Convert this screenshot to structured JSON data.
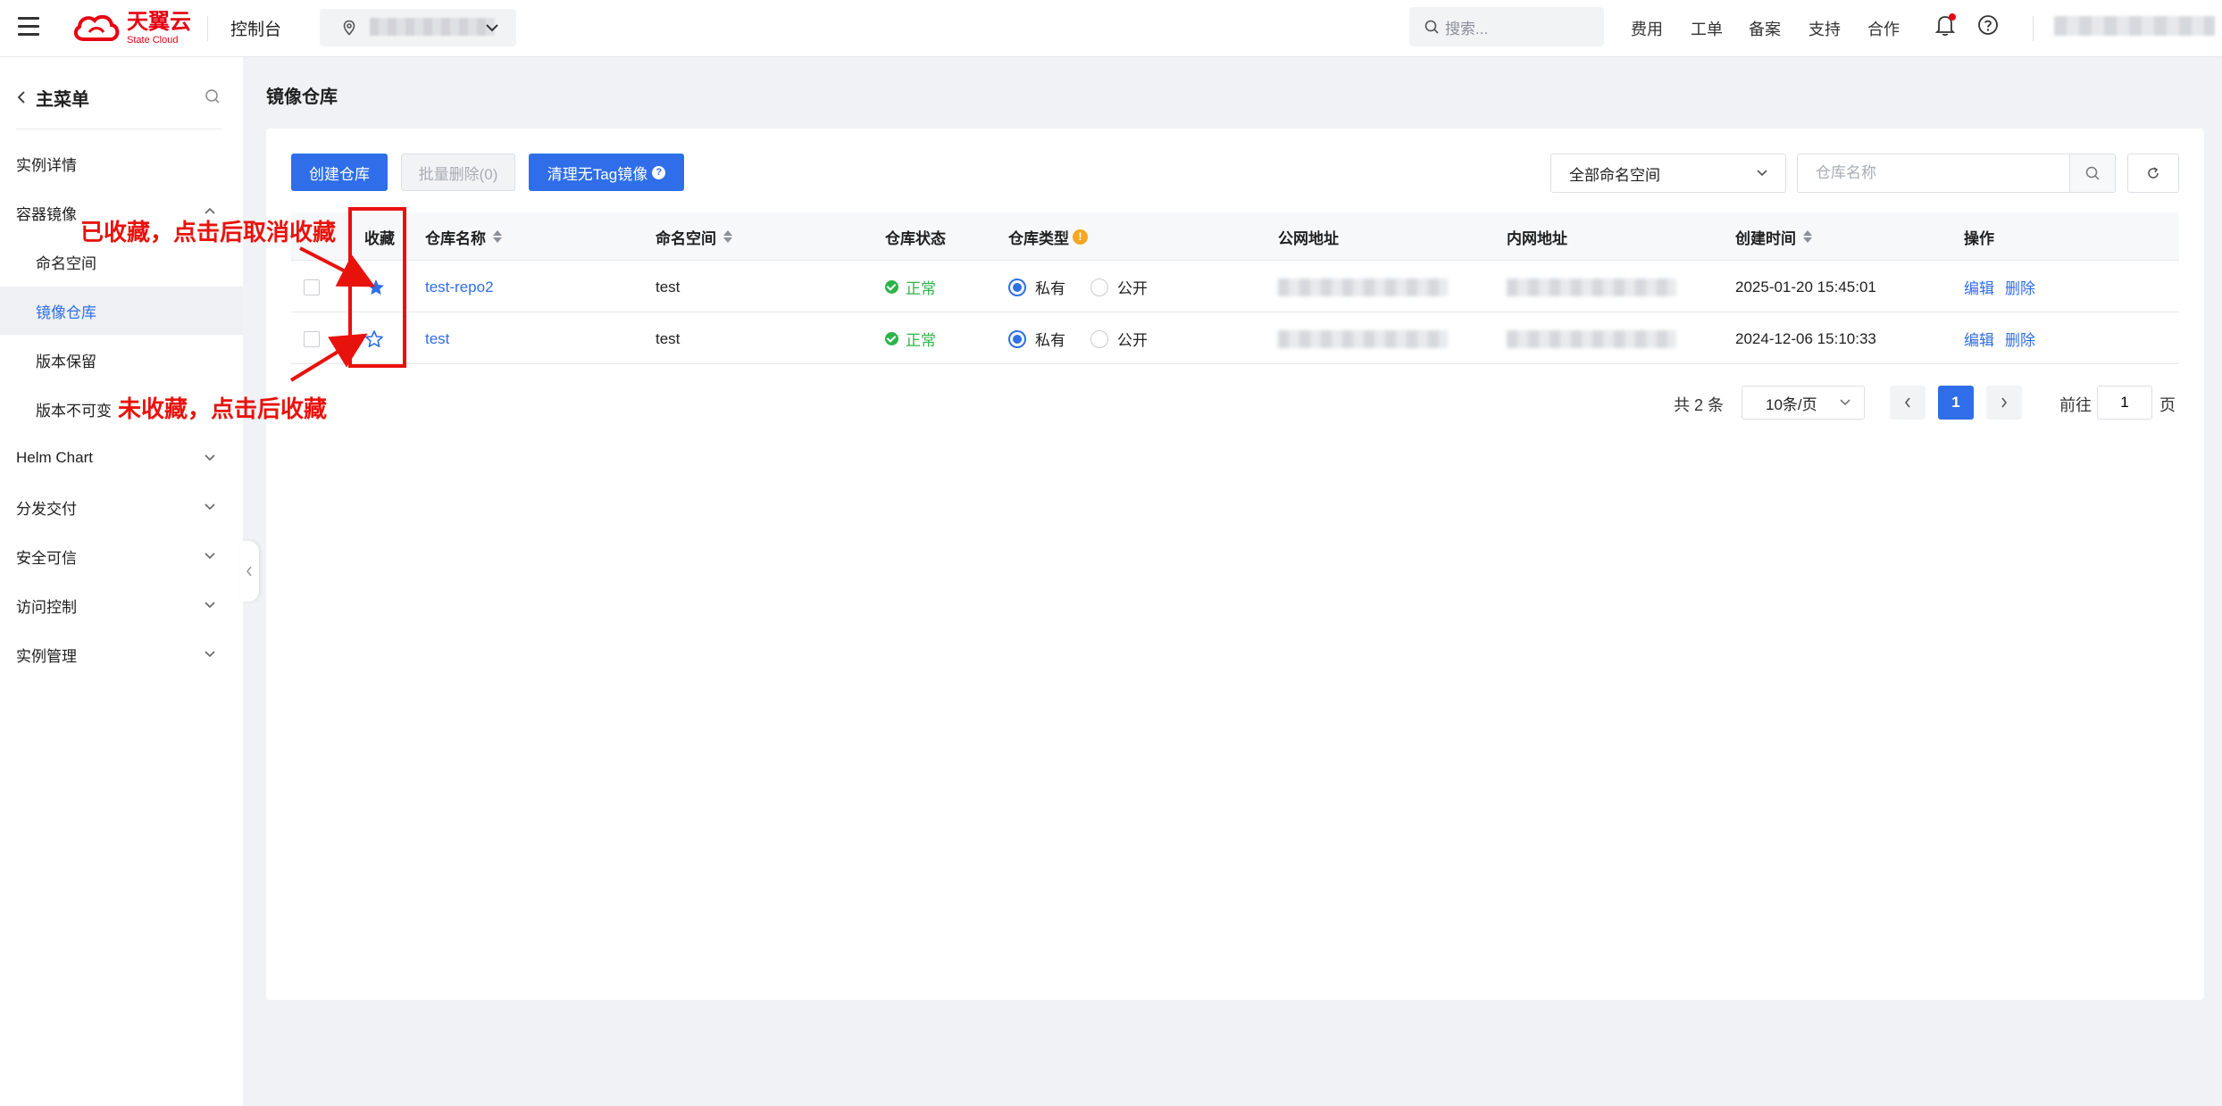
{
  "header": {
    "logo_cn": "天翼云",
    "logo_en": "State Cloud",
    "console": "控制台",
    "search_placeholder": "搜索...",
    "links": [
      "费用",
      "工单",
      "备案",
      "支持",
      "合作"
    ]
  },
  "sidebar": {
    "title": "主菜单",
    "items": [
      {
        "label": "实例详情"
      },
      {
        "label": "容器镜像"
      },
      {
        "label": "命名空间"
      },
      {
        "label": "镜像仓库"
      },
      {
        "label": "版本保留"
      },
      {
        "label": "版本不可变"
      },
      {
        "label": "Helm Chart"
      },
      {
        "label": "分发交付"
      },
      {
        "label": "安全可信"
      },
      {
        "label": "访问控制"
      },
      {
        "label": "实例管理"
      }
    ]
  },
  "page": {
    "title": "镜像仓库"
  },
  "toolbar": {
    "create": "创建仓库",
    "batch_delete": "批量删除(0)",
    "clean": "清理无Tag镜像",
    "clean_help": "?",
    "namespace_select": "全部命名空间",
    "search_placeholder": "仓库名称"
  },
  "table": {
    "headers": {
      "fav": "收藏",
      "name": "仓库名称",
      "namespace": "命名空间",
      "status": "仓库状态",
      "type": "仓库类型",
      "type_help": "!",
      "public_addr": "公网地址",
      "private_addr": "内网地址",
      "created": "创建时间",
      "actions": "操作"
    },
    "rows": [
      {
        "favorited": true,
        "name": "test-repo2",
        "namespace": "test",
        "status": "正常",
        "type_private": "私有",
        "type_public": "公开",
        "created": "2025-01-20 15:45:01",
        "edit": "编辑",
        "delete": "删除"
      },
      {
        "favorited": false,
        "name": "test",
        "namespace": "test",
        "status": "正常",
        "type_private": "私有",
        "type_public": "公开",
        "created": "2024-12-06 15:10:33",
        "edit": "编辑",
        "delete": "删除"
      }
    ]
  },
  "pagination": {
    "total": "共 2 条",
    "page_size": "10条/页",
    "current": "1",
    "goto_prefix": "前往",
    "goto_value": "1",
    "goto_suffix": "页"
  },
  "annotations": {
    "favorited": "已收藏，点击后取消收藏",
    "not_favorited": "未收藏，点击后收藏"
  },
  "colors": {
    "primary": "#2f6ee8",
    "success": "#2fb24a",
    "annotation": "#e8120c",
    "brand": "#e60012"
  }
}
